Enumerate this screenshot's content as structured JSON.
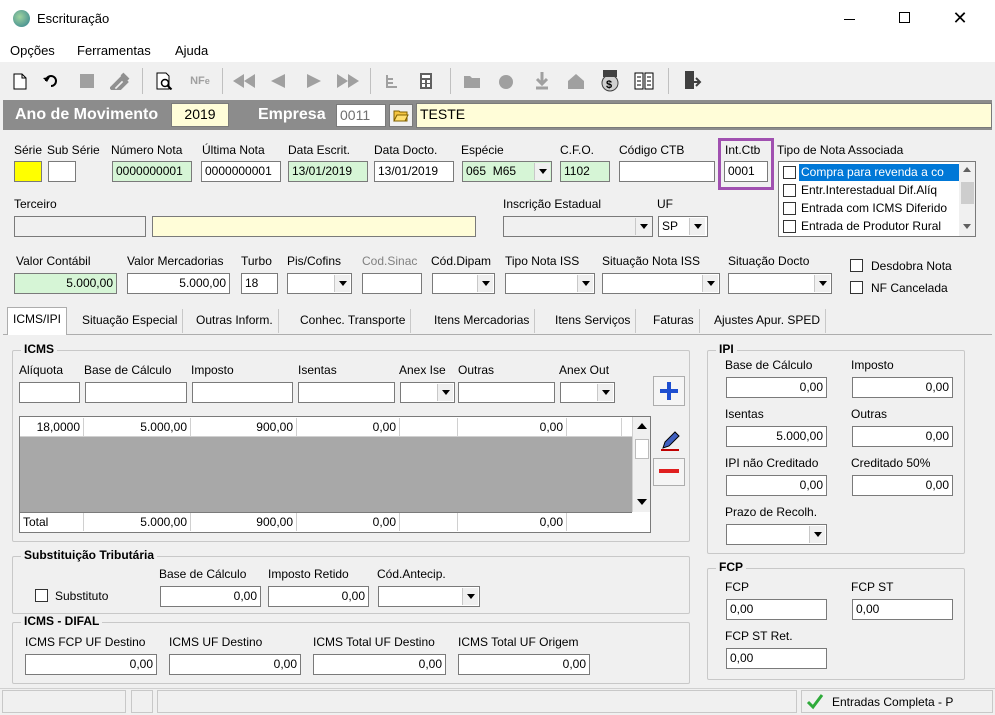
{
  "window": {
    "title": "Escrituração"
  },
  "menu": {
    "opcoes": "Opções",
    "ferramentas": "Ferramentas",
    "ajuda": "Ajuda"
  },
  "header": {
    "ano_label": "Ano de Movimento",
    "ano_value": "2019",
    "empresa_label": "Empresa",
    "empresa_code": "0011",
    "empresa_name": "TESTE"
  },
  "nota": {
    "serie_label": "Série",
    "subserie_label": "Sub Série",
    "numero_label": "Número Nota",
    "numero_value": "0000000001",
    "ultima_label": "Última Nota",
    "ultima_value": "0000000001",
    "data_escrit_label": "Data Escrit.",
    "data_escrit_value": "13/01/2019",
    "data_docto_label": "Data Docto.",
    "data_docto_value": "13/01/2019",
    "especie_label": "Espécie",
    "especie_code": "065",
    "especie_value": "M65",
    "cfo_label": "C.F.O.",
    "cfo_value": "1102",
    "codigo_ctb_label": "Código CTB",
    "int_ctb_label": "Int.Ctb",
    "int_ctb_value": "0001",
    "tipo_nota_label": "Tipo de Nota Associada",
    "tipo_nota_items": [
      "Compra para revenda a co",
      "Entr.Interestadual Dif.Alíq",
      "Entrada com ICMS Diferido",
      "Entrada de Produtor Rural"
    ],
    "terceiro_label": "Terceiro",
    "inscricao_label": "Inscrição Estadual",
    "uf_label": "UF",
    "uf_value": "SP",
    "valor_contabil_label": "Valor Contábil",
    "valor_contabil_value": "5.000,00",
    "valor_merc_label": "Valor Mercadorias",
    "valor_merc_value": "5.000,00",
    "turbo_label": "Turbo",
    "turbo_value": "18",
    "pis_label": "Pis/Cofins",
    "cod_sinac_label": "Cod.Sinac",
    "cod_dipam_label": "Cód.Dipam",
    "tipo_iss_label": "Tipo Nota ISS",
    "situacao_iss_label": "Situação Nota ISS",
    "situacao_docto_label": "Situação Docto",
    "desdobra_label": "Desdobra Nota",
    "nf_cancelada_label": "NF Cancelada"
  },
  "tabs": [
    "ICMS/IPI",
    "Situação Especial",
    "Outras Inform.",
    "Conhec. Transporte",
    "Itens Mercadorias",
    "Itens Serviços",
    "Faturas",
    "Ajustes Apur. SPED"
  ],
  "icms": {
    "title": "ICMS",
    "headers": [
      "Alíquota",
      "Base de Cálculo",
      "Imposto",
      "Isentas",
      "Anex Ise",
      "Outras",
      "Anex Out"
    ],
    "row": [
      "18,0000",
      "5.000,00",
      "900,00",
      "0,00",
      "",
      "0,00"
    ],
    "total_label": "Total",
    "total": [
      "5.000,00",
      "900,00",
      "0,00",
      "",
      "0,00"
    ]
  },
  "st": {
    "title": "Substituição Tributária",
    "substituto_label": "Substituto",
    "base_label": "Base de Cálculo",
    "base_value": "0,00",
    "imposto_label": "Imposto Retido",
    "imposto_value": "0,00",
    "antecip_label": "Cód.Antecip."
  },
  "difal": {
    "title": "ICMS - DIFAL",
    "fcp_label": "ICMS FCP UF Destino",
    "fcp_value": "0,00",
    "uf_dest_label": "ICMS UF Destino",
    "uf_dest_value": "0,00",
    "total_dest_label": "ICMS Total UF Destino",
    "total_dest_value": "0,00",
    "total_orig_label": "ICMS Total UF Origem",
    "total_orig_value": "0,00"
  },
  "ipi": {
    "title": "IPI",
    "base_label": "Base de Cálculo",
    "base_value": "0,00",
    "imposto_label": "Imposto",
    "imposto_value": "0,00",
    "isentas_label": "Isentas",
    "isentas_value": "5.000,00",
    "outras_label": "Outras",
    "outras_value": "0,00",
    "nao_cred_label": "IPI não Creditado",
    "nao_cred_value": "0,00",
    "cred50_label": "Creditado 50%",
    "cred50_value": "0,00",
    "prazo_label": "Prazo de Recolh."
  },
  "fcp": {
    "title": "FCP",
    "fcp_label": "FCP",
    "fcp_value": "0,00",
    "fcp_st_label": "FCP ST",
    "fcp_st_value": "0,00",
    "fcp_st_ret_label": "FCP ST Ret.",
    "fcp_st_ret_value": "0,00"
  },
  "status": {
    "text": "Entradas Completa - P"
  },
  "colors": {
    "header_bar": "#8c8c8c",
    "accent_purple": "#a050b0",
    "selection": "#0078d7",
    "yellow_field": "#ffff00"
  }
}
